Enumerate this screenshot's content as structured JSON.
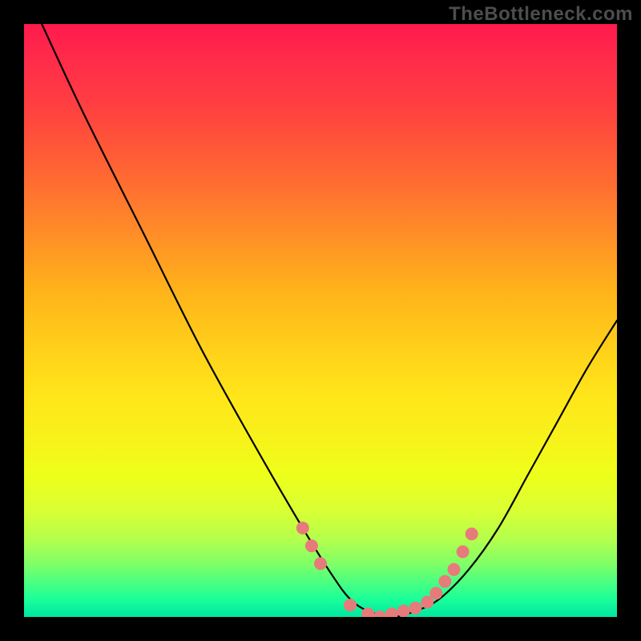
{
  "watermark": "TheBottleneck.com",
  "chart_data": {
    "type": "line",
    "title": "",
    "xlabel": "",
    "ylabel": "",
    "xlim": [
      0,
      100
    ],
    "ylim": [
      0,
      100
    ],
    "series": [
      {
        "name": "bottleneck-curve",
        "x": [
          3,
          10,
          20,
          30,
          40,
          47,
          52,
          55,
          58,
          62,
          66,
          70,
          75,
          80,
          85,
          90,
          95,
          100
        ],
        "y": [
          100,
          85,
          65,
          45,
          27,
          15,
          7,
          3,
          1,
          0,
          1,
          3,
          8,
          15,
          24,
          33,
          42,
          50
        ]
      }
    ],
    "marker_points": {
      "name": "highlight-dots",
      "x": [
        47,
        48.5,
        50,
        55,
        58,
        60,
        62,
        64,
        66,
        68,
        69.5,
        71,
        72.5,
        74,
        75.5
      ],
      "y": [
        15,
        12,
        9,
        2,
        0.5,
        0,
        0.5,
        1,
        1.5,
        2.5,
        4,
        6,
        8,
        11,
        14
      ]
    },
    "background_gradient": {
      "top": "#ff1a4d",
      "upper_mid": "#ff8c28",
      "mid": "#ffe61a",
      "lower_mid": "#b3ff4d",
      "bottom": "#00e6a0"
    }
  }
}
